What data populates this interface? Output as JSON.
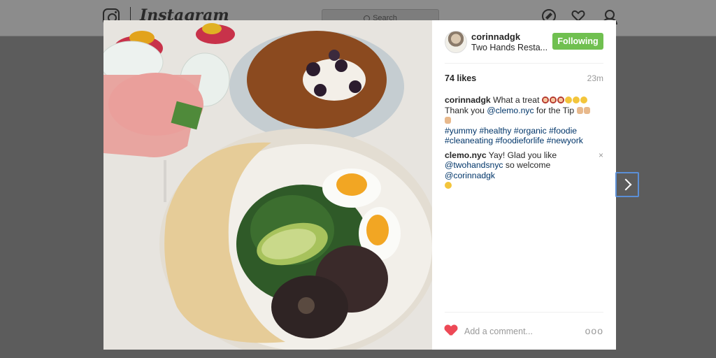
{
  "header": {
    "wordmark": "Instagram",
    "search_placeholder": "Search"
  },
  "post": {
    "username": "corinnadgk",
    "location": "Two Hands Resta...",
    "follow_label": "Following",
    "likes": "74 likes",
    "time_ago": "23m",
    "comments": [
      {
        "user": "corinnadgk",
        "text1": "What a treat",
        "text2": "Thank you",
        "mention": "@clemo.nyc",
        "text3": "for the Tip",
        "hashtags": [
          "#yummy",
          "#healthy",
          "#organic",
          "#foodie",
          "#cleaneating",
          "#foodieforlife",
          "#newyork"
        ]
      },
      {
        "user": "clemo.nyc",
        "text1": "Yay! Glad you like",
        "mention1": "@twohandsnyc",
        "text2": "so welcome",
        "mention2": "@corinnadgk",
        "close": "×"
      }
    ],
    "add_comment_placeholder": "Add a comment...",
    "more_label": "ooo"
  },
  "colors": {
    "follow_button": "#70c050",
    "like_heart": "#ed4956",
    "link": "#003569"
  }
}
